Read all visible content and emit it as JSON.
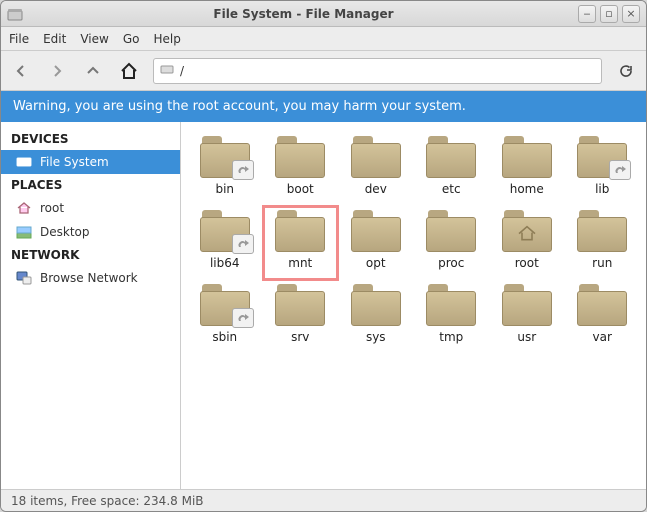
{
  "window": {
    "title": "File System - File Manager"
  },
  "menu": {
    "file": "File",
    "edit": "Edit",
    "view": "View",
    "go": "Go",
    "help": "Help"
  },
  "path": {
    "value": "/"
  },
  "warning": "Warning, you are using the root account, you may harm your system.",
  "sidebar": {
    "devices": {
      "header": "DEVICES",
      "items": [
        {
          "label": "File System"
        }
      ]
    },
    "places": {
      "header": "PLACES",
      "items": [
        {
          "label": "root"
        },
        {
          "label": "Desktop"
        }
      ]
    },
    "network": {
      "header": "NETWORK",
      "items": [
        {
          "label": "Browse Network"
        }
      ]
    }
  },
  "folders": [
    {
      "name": "bin",
      "link": true
    },
    {
      "name": "boot"
    },
    {
      "name": "dev"
    },
    {
      "name": "etc"
    },
    {
      "name": "home"
    },
    {
      "name": "lib",
      "link": true
    },
    {
      "name": "lib64",
      "link": true
    },
    {
      "name": "mnt",
      "highlight": true
    },
    {
      "name": "opt"
    },
    {
      "name": "proc"
    },
    {
      "name": "root",
      "homeicon": true
    },
    {
      "name": "run"
    },
    {
      "name": "sbin",
      "link": true
    },
    {
      "name": "srv"
    },
    {
      "name": "sys"
    },
    {
      "name": "tmp"
    },
    {
      "name": "usr"
    },
    {
      "name": "var"
    }
  ],
  "status": "18 items, Free space: 234.8 MiB"
}
